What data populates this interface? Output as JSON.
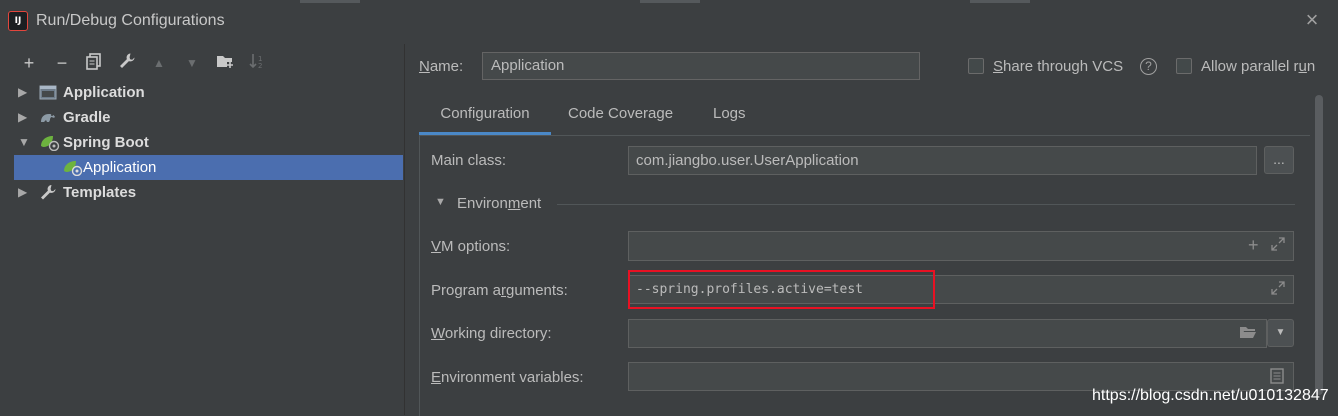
{
  "window": {
    "title": "Run/Debug Configurations",
    "logo_text": "IJ",
    "close_glyph": "×"
  },
  "toolbar": {
    "add": "+",
    "remove": "−",
    "copy": "⧉",
    "edit": "🔧",
    "move_up": "▲",
    "move_down": "▼",
    "folder": "📁",
    "sort": "↓²"
  },
  "tree": {
    "items": [
      {
        "label": "Application",
        "icon": "application-icon",
        "bold": true,
        "expanded": false
      },
      {
        "label": "Gradle",
        "icon": "gradle-icon",
        "bold": true,
        "expanded": false
      },
      {
        "label": "Spring Boot",
        "icon": "spring-boot-icon",
        "bold": true,
        "expanded": true
      },
      {
        "label": "Application",
        "icon": "spring-boot-icon",
        "bold": false,
        "selected": true
      },
      {
        "label": "Templates",
        "icon": "wrench-icon",
        "bold": true,
        "expanded": false
      }
    ]
  },
  "name": {
    "label_prefix": "",
    "label_mnemonic": "N",
    "label_rest": "ame:",
    "value": "Application"
  },
  "options": {
    "share_vcs_mnemonic": "S",
    "share_vcs_rest": "hare through VCS",
    "share_vcs_checked": false,
    "help_glyph": "?",
    "parallel_prefix": "Allow parallel r",
    "parallel_mnemonic": "u",
    "parallel_rest": "n",
    "parallel_checked": false
  },
  "tabs": [
    {
      "label": "Configuration",
      "active": true
    },
    {
      "label": "Code Coverage",
      "active": false
    },
    {
      "label": "Logs",
      "active": false
    }
  ],
  "config": {
    "main_class_label": "Main class:",
    "main_class_value": "com.jiangbo.user.UserApplication",
    "browse_label": "...",
    "environment_prefix": "Environ",
    "environment_mnemonic": "m",
    "environment_rest": "ent",
    "vm_options_mnemonic": "V",
    "vm_options_rest": "M options:",
    "vm_options_value": "",
    "program_args_prefix": "Program a",
    "program_args_mnemonic": "r",
    "program_args_rest": "guments:",
    "program_args_value": "--spring.profiles.active=test",
    "working_dir_mnemonic": "W",
    "working_dir_rest": "orking directory:",
    "working_dir_value": "",
    "env_vars_mnemonic": "E",
    "env_vars_rest": "nvironment variables:",
    "env_vars_value": ""
  },
  "colors": {
    "background": "#3c3f41",
    "selection": "#4b6eaf",
    "tab_underline": "#4a88c7",
    "highlight_box": "#e81123"
  },
  "watermark": "https://blog.csdn.net/u010132847"
}
